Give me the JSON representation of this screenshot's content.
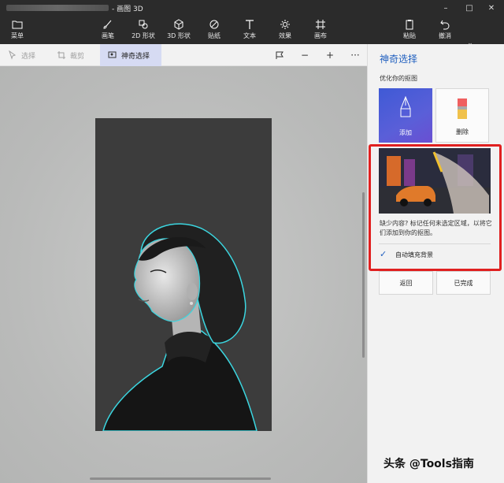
{
  "window": {
    "title": "- 画图 3D",
    "controls": [
      "–",
      "□",
      "✕"
    ]
  },
  "ribbon": {
    "items": [
      {
        "label": "菜单",
        "icon": "folder-icon"
      },
      {
        "label": "画笔",
        "icon": "brush-icon"
      },
      {
        "label": "2D 形状",
        "icon": "shapes-2d-icon"
      },
      {
        "label": "3D 形状",
        "icon": "cube-icon"
      },
      {
        "label": "贴纸",
        "icon": "sticker-icon"
      },
      {
        "label": "文本",
        "icon": "text-icon"
      },
      {
        "label": "效果",
        "icon": "sun-icon"
      },
      {
        "label": "画布",
        "icon": "canvas-icon"
      }
    ],
    "paste_label": "粘贴",
    "undo_label": "撤消"
  },
  "canvas_toolbar": {
    "select_label": "选择",
    "crop_label": "裁剪",
    "magic_select_label": "神奇选择",
    "zoom_out": "−",
    "zoom_in": "+",
    "more": "···"
  },
  "panel": {
    "title": "神奇选择",
    "subtitle": "优化你的抠图",
    "add_label": "添加",
    "remove_label": "删除",
    "description": "缺少内容? 标记任何未选定区域，以将它们添加到你的抠图。",
    "autofill_label": "自动填充背景",
    "autofill_checked": true,
    "back_label": "返回",
    "done_label": "已完成"
  },
  "watermark": "头条 @Tools指南",
  "colors": {
    "accent": "#1f5fbf",
    "highlight_box": "#e02020",
    "ribbon_bg": "#2b2b2b",
    "selection_outline": "#3bd6e0"
  }
}
